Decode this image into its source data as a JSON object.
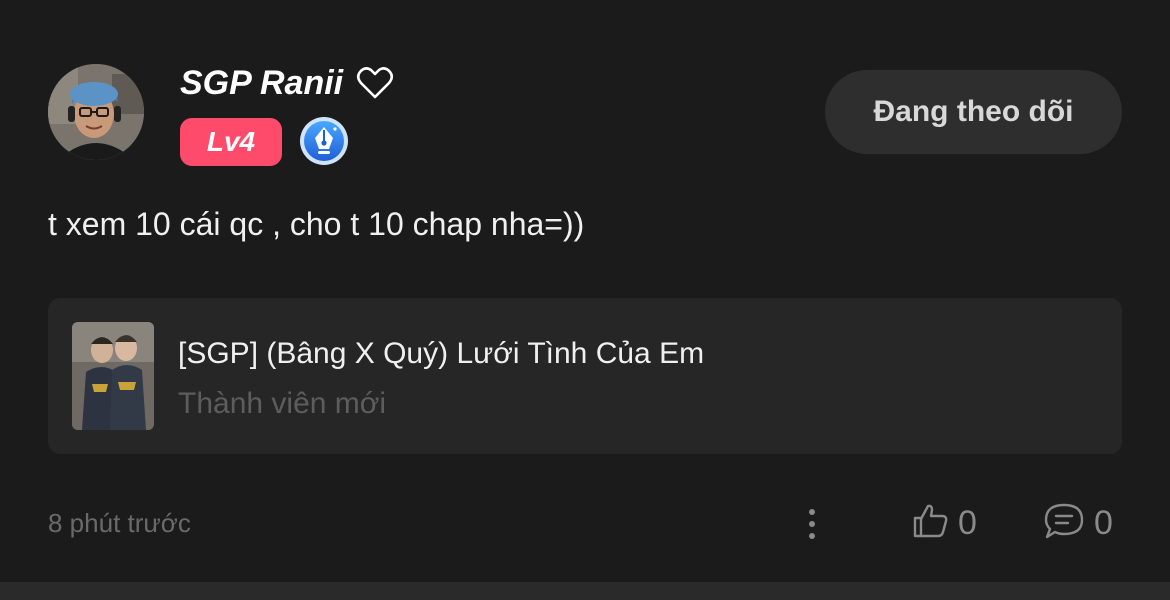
{
  "author": {
    "name": "SGP Ranii",
    "heart_icon": "heart-outline-icon",
    "level": "Lv4",
    "level_color": "#ff4b6b",
    "writer_badge_icon": "pen-nib-badge-icon"
  },
  "follow_button": {
    "label": "Đang theo dõi"
  },
  "post": {
    "text": "t xem 10 cái qc , cho t 10 chap nha=))"
  },
  "linked_story": {
    "title": "[SGP] (Bâng X Quý) Lưới Tình Của Em",
    "subtitle": "Thành viên mới"
  },
  "footer": {
    "timestamp": "8 phút trước",
    "likes": "0",
    "comments": "0",
    "icons": [
      "more-vertical-icon",
      "thumbs-up-icon",
      "comment-icon"
    ]
  },
  "colors": {
    "background": "#1b1b1b",
    "card": "#262626",
    "button": "#2e2e2e",
    "muted_text": "#6a6a6a"
  }
}
